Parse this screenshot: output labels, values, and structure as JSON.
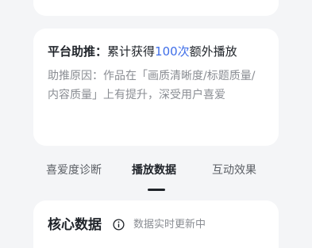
{
  "boost": {
    "title": "平台助推：",
    "prefix": "累计获得",
    "count": "100次",
    "suffix": "额外播放",
    "reason": "助推原因：作品在「画质清晰度/标题质量/内容质量」上有提升，深受用户喜爱"
  },
  "tabs": [
    {
      "label": "喜爱度诊断",
      "active": false
    },
    {
      "label": "播放数据",
      "active": true
    },
    {
      "label": "互动效果",
      "active": false
    }
  ],
  "core": {
    "title": "核心数据",
    "info_icon": "info-circle-icon",
    "subtitle": "数据实时更新中"
  },
  "colors": {
    "background": "#f4f5f7",
    "card": "#ffffff",
    "accent": "#3f6ee8",
    "secondary_text": "#8a8d93"
  }
}
